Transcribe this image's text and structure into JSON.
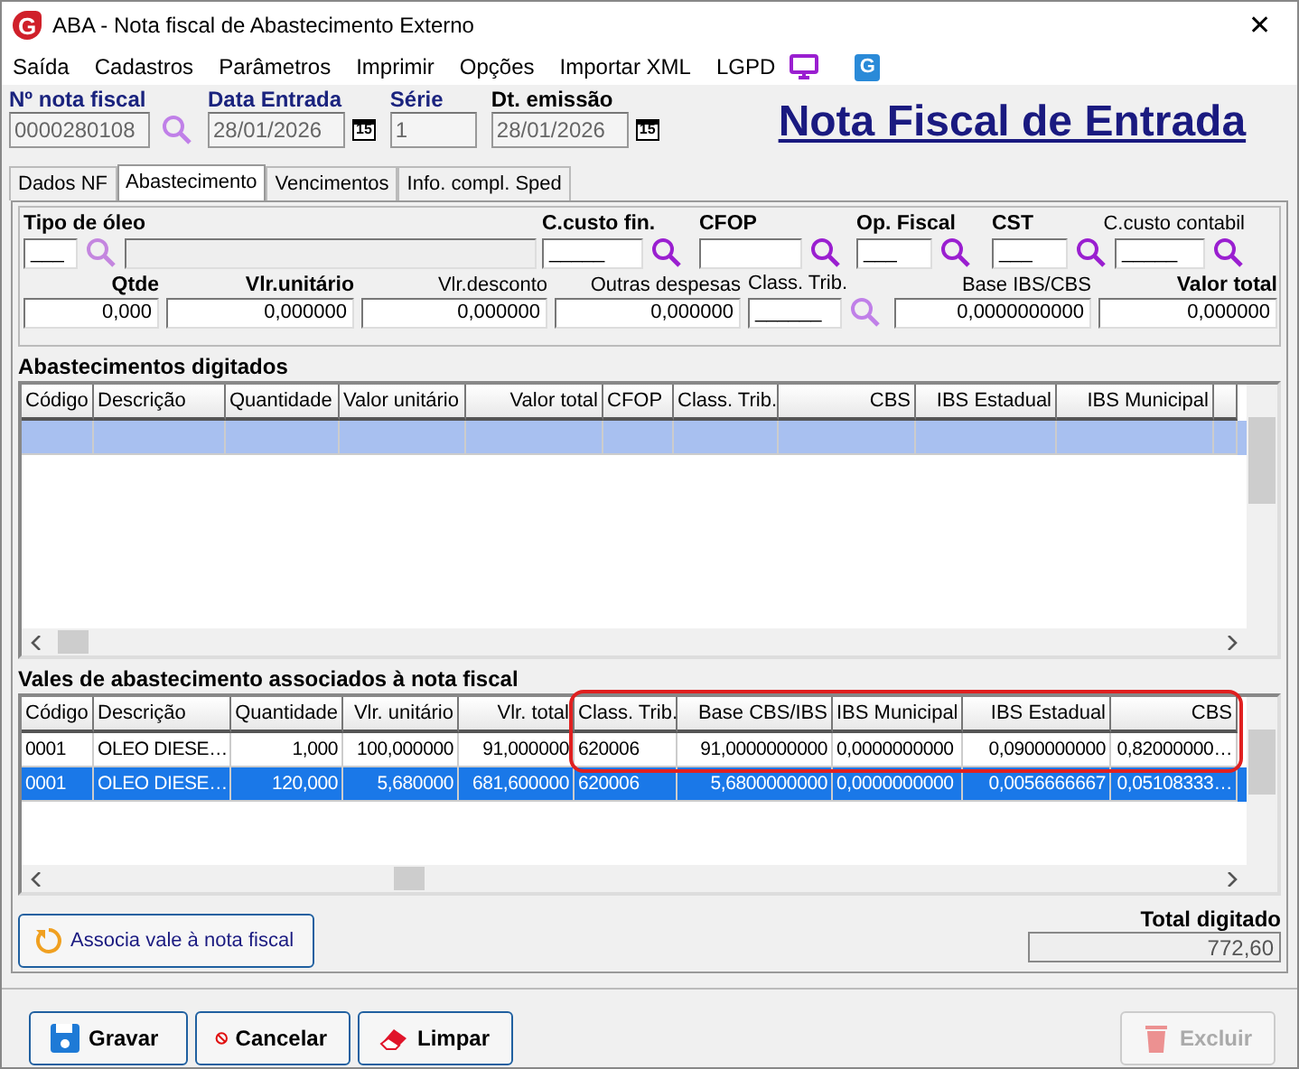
{
  "window": {
    "logo": "G",
    "title": "ABA - Nota fiscal de Abastecimento Externo",
    "close": "✕"
  },
  "menu": [
    "Saída",
    "Cadastros",
    "Parâmetros",
    "Imprimir",
    "Opções",
    "Importar XML",
    "LGPD"
  ],
  "menu_badge": "G",
  "header": {
    "fields": [
      {
        "kind": "search",
        "label": "Nº nota fiscal",
        "value": "0000280108",
        "required": true
      },
      {
        "kind": "date",
        "label": "Data Entrada",
        "value": "28/01/2026",
        "calendar": "15",
        "required": true
      },
      {
        "kind": "plain",
        "label": "Série",
        "value": "1",
        "required": true
      },
      {
        "kind": "date",
        "label": "Dt. emissão",
        "value": "28/01/2026",
        "calendar": "15",
        "required": false
      }
    ],
    "page_title": "Nota Fiscal de Entrada"
  },
  "tabs": [
    {
      "label": "Dados NF",
      "selected": false
    },
    {
      "label": "Abastecimento",
      "selected": true
    },
    {
      "label": "Vencimentos",
      "selected": false
    },
    {
      "label": "Info. compl. Sped",
      "selected": false
    }
  ],
  "form_row1": [
    {
      "label": "Tipo de óleo",
      "value": "___",
      "bold": true
    },
    {
      "label": "C.custo fin.",
      "value": "_____",
      "bold": true
    },
    {
      "label": "CFOP",
      "bold": true
    },
    {
      "label": "Op. Fiscal",
      "value": "___",
      "bold": true
    },
    {
      "label": "CST",
      "value": "___",
      "bold": true
    },
    {
      "label": "C.custo contabil",
      "value": "_____",
      "bold": false
    }
  ],
  "form_row2": [
    {
      "label": "Qtde",
      "value": "0,000",
      "bold": true
    },
    {
      "label": "Vlr.unitário",
      "value": "0,000000",
      "bold": true
    },
    {
      "label": "Vlr.desconto",
      "value": "0,000000",
      "bold": false
    },
    {
      "label": "Outras despesas",
      "value": "0,000000",
      "bold": false
    },
    {
      "label": "Class. Trib.",
      "value": "______",
      "bold": false,
      "search": true
    },
    {
      "label": "Base IBS/CBS",
      "value": "0,0000000000",
      "bold": false
    },
    {
      "label": "Valor total",
      "value": "0,000000",
      "bold": true
    }
  ],
  "grid_digitados": {
    "title": "Abastecimentos digitados",
    "columns": [
      {
        "label": "Código"
      },
      {
        "label": "Descrição"
      },
      {
        "label": "Quantidade"
      },
      {
        "label": "Valor unitário"
      },
      {
        "label": "Valor total"
      },
      {
        "label": "CFOP"
      },
      {
        "label": "Class. Trib."
      },
      {
        "label": "CBS"
      },
      {
        "label": "IBS Estadual"
      },
      {
        "label": "IBS Municipal"
      }
    ],
    "rows": [
      {
        "selected": true,
        "cells": []
      }
    ]
  },
  "grid_vales": {
    "title": "Vales de abastecimento associados à nota fiscal",
    "outlined": true,
    "columns": [
      {
        "label": "Código"
      },
      {
        "label": "Descrição"
      },
      {
        "label": "Quantidade"
      },
      {
        "label": "Vlr. unitário"
      },
      {
        "label": "Vlr. total"
      },
      {
        "label": "Class. Trib."
      },
      {
        "label": "Base CBS/IBS"
      },
      {
        "label": "IBS Municipal"
      },
      {
        "label": "IBS Estadual"
      },
      {
        "label": "CBS"
      }
    ],
    "rows": [
      {
        "selected": false,
        "cells": [
          "0001",
          "OLEO DIESE…",
          "1,000",
          "100,000000",
          "91,000000",
          "620006",
          "91,0000000000",
          "0,0000000000",
          "0,0900000000",
          "0,82000000…"
        ]
      },
      {
        "selected": true,
        "cells": [
          "0001",
          "OLEO DIESE…",
          "120,000",
          "5,680000",
          "681,600000",
          "620006",
          "5,6800000000",
          "0,0000000000",
          "0,0056666667",
          "0,05108333…"
        ]
      }
    ]
  },
  "associate_button": "Associa vale à nota fiscal",
  "total": {
    "label": "Total digitado",
    "value": "772,60"
  },
  "buttons": [
    {
      "kind": "save",
      "label": "Gravar",
      "disabled": false
    },
    {
      "kind": "cancel",
      "label": "Cancelar",
      "disabled": false
    },
    {
      "kind": "clear",
      "label": "Limpar",
      "disabled": false
    },
    {
      "kind": "delete",
      "label": "Excluir",
      "disabled": true
    }
  ]
}
